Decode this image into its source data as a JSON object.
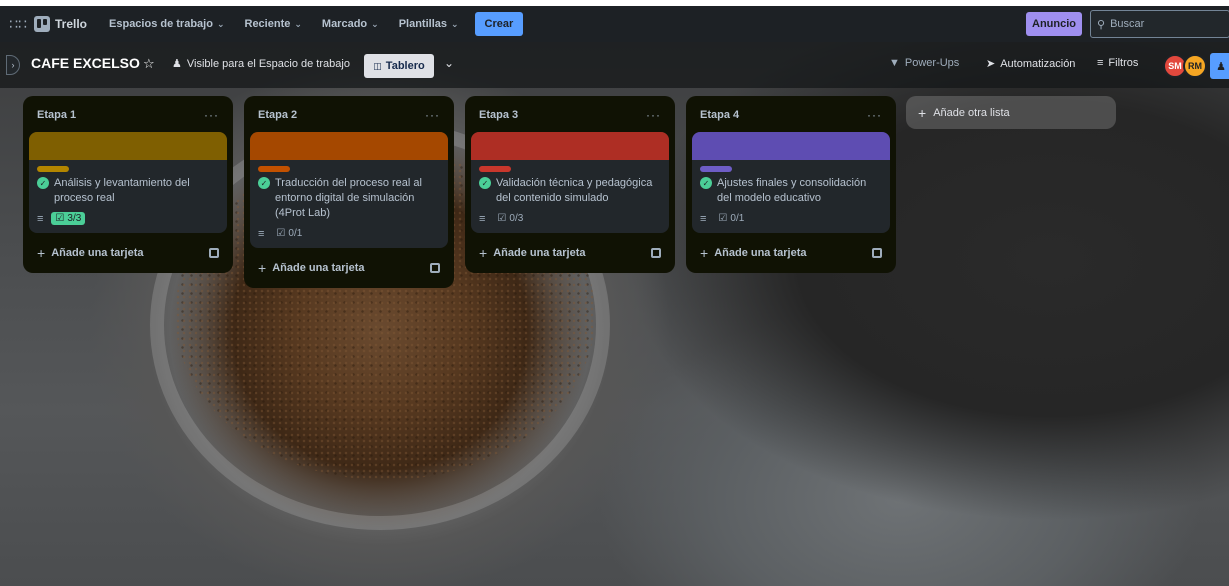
{
  "topnav": {
    "brand": "Trello",
    "menus": [
      {
        "label": "Espacios de trabajo"
      },
      {
        "label": "Reciente"
      },
      {
        "label": "Marcado"
      },
      {
        "label": "Plantillas"
      }
    ],
    "create_label": "Crear",
    "announcement_label": "Anuncio",
    "search_placeholder": "Buscar"
  },
  "board": {
    "title": "CAFE EXCELSO",
    "visibility": "Visible para el Espacio de trabajo",
    "view_label": "Tablero",
    "powerups_label": "Power-Ups",
    "automation_label": "Automatización",
    "filters_label": "Filtros",
    "members": [
      "SM",
      "RM"
    ]
  },
  "lists": [
    {
      "title": "Etapa 1",
      "cover_color": "#7f5f01",
      "label_color": "#b38600",
      "card_title": "Análisis y levantamiento del proceso real",
      "checklist": "3/3",
      "checklist_complete": true,
      "add_card_label": "Añade una tarjeta"
    },
    {
      "title": "Etapa 2",
      "cover_color": "#a54800",
      "label_color": "#c25100",
      "card_title": "Traducción del proceso real al entorno digital de simulación (4Prot Lab)",
      "checklist": "0/1",
      "checklist_complete": false,
      "add_card_label": "Añade una tarjeta"
    },
    {
      "title": "Etapa 3",
      "cover_color": "#ae2e24",
      "label_color": "#c9372c",
      "card_title": "Validación técnica y pedagógica del contenido simulado",
      "checklist": "0/3",
      "checklist_complete": false,
      "add_card_label": "Añade una tarjeta"
    },
    {
      "title": "Etapa 4",
      "cover_color": "#5e4db2",
      "label_color": "#6e5dc6",
      "card_title": "Ajustes finales y consolidación del modelo educativo",
      "checklist": "0/1",
      "checklist_complete": false,
      "add_card_label": "Añade una tarjeta"
    }
  ],
  "add_list_label": "Añade otra lista"
}
